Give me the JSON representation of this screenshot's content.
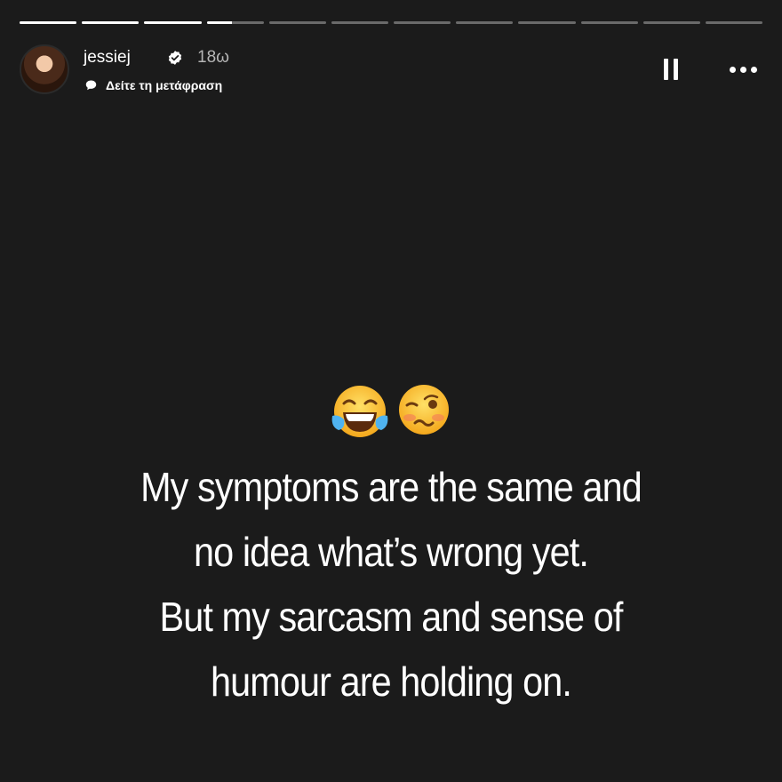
{
  "story": {
    "progress": {
      "segment_count": 12,
      "completed_segments": 3,
      "current_segment_fraction": 0.45
    },
    "header": {
      "username": "jessiej",
      "verified": true,
      "time_ago": "18ω",
      "translate_label": "Δείτε τη μετάφραση"
    },
    "caption": {
      "emojis": [
        "😂",
        "🥴"
      ],
      "lines": [
        "My symptoms are the same and",
        "no idea what’s wrong yet.",
        "But my sarcasm and sense of",
        "humour are holding on."
      ]
    },
    "icons": {
      "pause": "pause-icon",
      "more": "more-options-icon",
      "verified": "verified-badge-icon",
      "translate": "speech-bubble-icon"
    },
    "colors": {
      "background": "#1b1b1b",
      "text": "#ffffff",
      "muted_text": "#b5b5b5",
      "verified_badge": "#ffffff"
    }
  }
}
